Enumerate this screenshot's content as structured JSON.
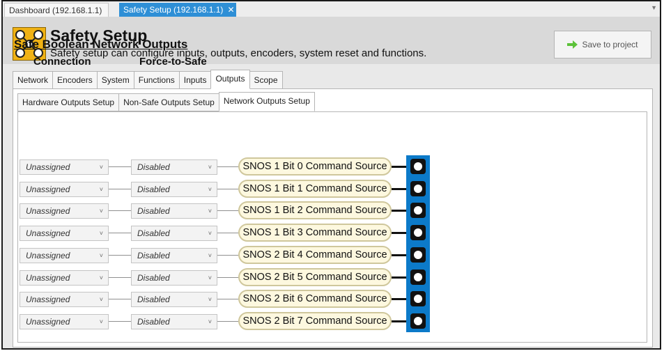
{
  "doc_tabs": {
    "dashboard": "Dashboard (192.168.1.1)",
    "safety_setup": "Safety Setup (192.168.1.1)",
    "close_glyph": "✕",
    "overflow_glyph": "▼"
  },
  "header": {
    "title": "Safety Setup",
    "subtitle": "Safety setup can configure inputs, outputs, encoders, system reset and functions.",
    "save_label": "Save to project"
  },
  "main_tabs": [
    {
      "label": "Network",
      "active": false
    },
    {
      "label": "Encoders",
      "active": false
    },
    {
      "label": "System",
      "active": false
    },
    {
      "label": "Functions",
      "active": false
    },
    {
      "label": "Inputs",
      "active": false
    },
    {
      "label": "Outputs",
      "active": true
    },
    {
      "label": "Scope",
      "active": false
    }
  ],
  "sub_tabs": [
    {
      "label": "Hardware Outputs Setup",
      "active": false
    },
    {
      "label": "Non-Safe Outputs Setup",
      "active": false
    },
    {
      "label": "Network Outputs Setup",
      "active": true
    }
  ],
  "section": {
    "title": "Safe Boolean Network Outputs",
    "connection_header": "Connection",
    "force_header": "Force-to-Safe"
  },
  "chevron_glyph": "˅",
  "outputs": [
    {
      "connection": "Unassigned",
      "force": "Disabled",
      "source": "SNOS 1 Bit 0 Command Source"
    },
    {
      "connection": "Unassigned",
      "force": "Disabled",
      "source": "SNOS 1 Bit 1 Command Source"
    },
    {
      "connection": "Unassigned",
      "force": "Disabled",
      "source": "SNOS 1 Bit 2 Command Source"
    },
    {
      "connection": "Unassigned",
      "force": "Disabled",
      "source": "SNOS 1 Bit 3 Command Source"
    },
    {
      "connection": "Unassigned",
      "force": "Disabled",
      "source": "SNOS 2 Bit 4 Command Source"
    },
    {
      "connection": "Unassigned",
      "force": "Disabled",
      "source": "SNOS 2 Bit 5 Command Source"
    },
    {
      "connection": "Unassigned",
      "force": "Disabled",
      "source": "SNOS 2 Bit 6 Command Source"
    },
    {
      "connection": "Unassigned",
      "force": "Disabled",
      "source": "SNOS 2 Bit 7 Command Source"
    }
  ],
  "colors": {
    "active_doc_tab": "#2e8fd6",
    "bus": "#0c7ac9",
    "logo": "#f0b214",
    "pill_fill": "#fdf8df",
    "pill_border": "#cfc79c"
  },
  "icons": {
    "logo": "safety-network-logo-icon",
    "save": "green-arrow-icon",
    "output_node": "output-terminal-icon"
  }
}
